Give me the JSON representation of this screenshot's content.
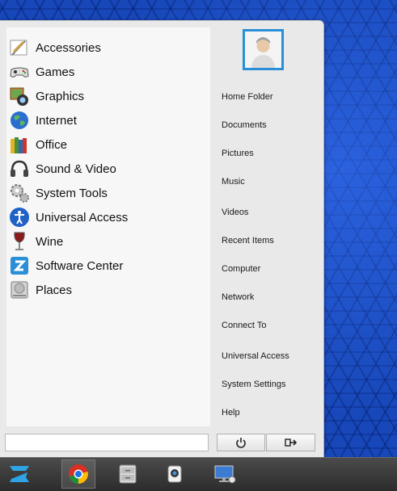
{
  "menu": {
    "apps": [
      {
        "label": "Accessories",
        "icon": "accessories-icon"
      },
      {
        "label": "Games",
        "icon": "games-icon"
      },
      {
        "label": "Graphics",
        "icon": "graphics-icon"
      },
      {
        "label": "Internet",
        "icon": "internet-icon"
      },
      {
        "label": "Office",
        "icon": "office-icon"
      },
      {
        "label": "Sound & Video",
        "icon": "sound-video-icon"
      },
      {
        "label": "System Tools",
        "icon": "system-tools-icon"
      },
      {
        "label": "Universal Access",
        "icon": "universal-access-icon"
      },
      {
        "label": "Wine",
        "icon": "wine-icon"
      },
      {
        "label": "Software Center",
        "icon": "software-center-icon"
      },
      {
        "label": "Places",
        "icon": "places-icon"
      }
    ],
    "places": [
      {
        "label": "Home Folder"
      },
      {
        "label": "Documents"
      },
      {
        "label": "Pictures"
      },
      {
        "label": "Music"
      },
      {
        "label": "Videos"
      },
      {
        "label": "Recent Items"
      },
      {
        "label": "Computer"
      },
      {
        "label": "Network"
      },
      {
        "label": "Connect To"
      },
      {
        "label": "Universal Access"
      },
      {
        "label": "System Settings"
      },
      {
        "label": "Help"
      }
    ],
    "search": {
      "value": ""
    }
  },
  "colors": {
    "accent": "#2a8fd6",
    "desktop": "#1747b8"
  }
}
